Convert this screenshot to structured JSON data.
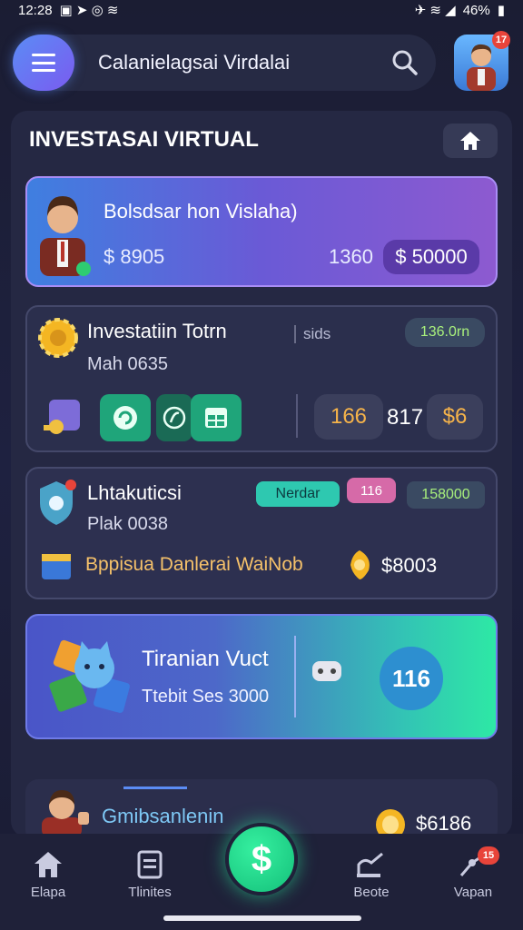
{
  "status": {
    "time": "12:28",
    "battery": "46%"
  },
  "topbar": {
    "title": "Calanielagsai Virdalai"
  },
  "section": {
    "title": "INVESTASAI VIRTUAL"
  },
  "card1": {
    "name": "Bolsdsar hon Vislaha)",
    "amount": "$ 8905",
    "count": "1360",
    "pill": "$ 50000"
  },
  "card2": {
    "title": "Investatiin Totrn",
    "subtitle": "Mah 0635",
    "side": "sids",
    "tag": "136.0rn",
    "stat1": "166",
    "stat2": "817",
    "stat3": "$6"
  },
  "card3": {
    "title": "Lhtakuticsi",
    "subtitle": "Plak 0038",
    "pill1": "Nerdar",
    "pill2": "116",
    "pill3": "158000",
    "desc": "Bppisua Danlerai WaiNob",
    "amount": "$8003"
  },
  "card4": {
    "title": "Tiranian Vuct",
    "subtitle": "Ttebit Ses 3000",
    "circle": "116"
  },
  "card5": {
    "title": "Gmibsanlenin",
    "amount": "$6186"
  },
  "nav": [
    {
      "label": "Elapa",
      "icon": "home-icon"
    },
    {
      "label": "Tlinites",
      "icon": "document-icon"
    },
    {
      "label": "Beote",
      "icon": "chart-edit-icon"
    },
    {
      "label": "Vapan",
      "icon": "network-icon",
      "badge": "15"
    }
  ],
  "fab": {
    "symbol": "$"
  },
  "badges": {
    "avatar": "17"
  },
  "colors": {
    "accent": "#2ee8a5",
    "brand": "#5b8cf5",
    "card_green": "#1fa57a"
  }
}
